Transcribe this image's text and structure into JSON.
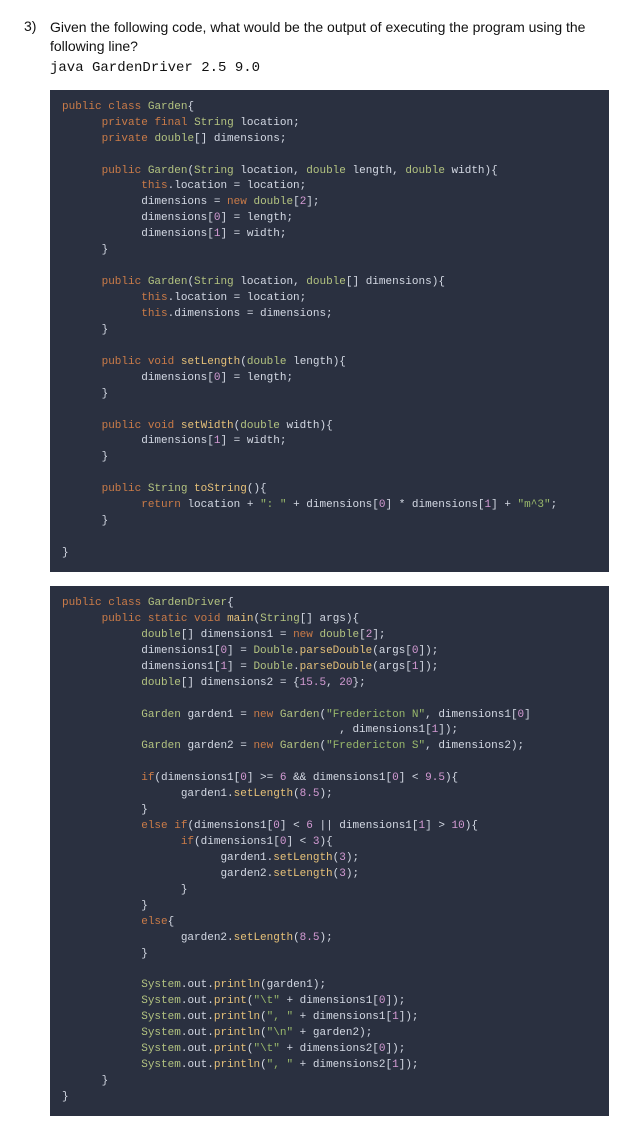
{
  "question": {
    "number": "3)",
    "prompt": "Given the following code, what would be the output of executing the program using the following line?",
    "command": "java GardenDriver 2.5 9.0"
  },
  "code1": {
    "tokens": [
      [
        "kw",
        "public"
      ],
      [
        "sp",
        " "
      ],
      [
        "kw",
        "class"
      ],
      [
        "sp",
        " "
      ],
      [
        "type",
        "Garden"
      ],
      [
        "punct",
        "{"
      ],
      [
        "nl"
      ],
      [
        "sp",
        "      "
      ],
      [
        "kw",
        "private"
      ],
      [
        "sp",
        " "
      ],
      [
        "kw",
        "final"
      ],
      [
        "sp",
        " "
      ],
      [
        "type",
        "String"
      ],
      [
        "sp",
        " "
      ],
      [
        "id",
        "location;"
      ],
      [
        "nl"
      ],
      [
        "sp",
        "      "
      ],
      [
        "kw",
        "private"
      ],
      [
        "sp",
        " "
      ],
      [
        "type",
        "double"
      ],
      [
        "punct",
        "[]"
      ],
      [
        "sp",
        " "
      ],
      [
        "id",
        "dimensions;"
      ],
      [
        "nl"
      ],
      [
        "nl"
      ],
      [
        "sp",
        "      "
      ],
      [
        "kw",
        "public"
      ],
      [
        "sp",
        " "
      ],
      [
        "type",
        "Garden"
      ],
      [
        "punct",
        "("
      ],
      [
        "type",
        "String"
      ],
      [
        "sp",
        " "
      ],
      [
        "id",
        "location, "
      ],
      [
        "type",
        "double"
      ],
      [
        "sp",
        " "
      ],
      [
        "id",
        "length, "
      ],
      [
        "type",
        "double"
      ],
      [
        "sp",
        " "
      ],
      [
        "id",
        "width"
      ],
      [
        "punct",
        "){"
      ],
      [
        "nl"
      ],
      [
        "sp",
        "            "
      ],
      [
        "kw",
        "this"
      ],
      [
        "punct",
        "."
      ],
      [
        "id",
        "location = location;"
      ],
      [
        "nl"
      ],
      [
        "sp",
        "            "
      ],
      [
        "id",
        "dimensions = "
      ],
      [
        "kw",
        "new"
      ],
      [
        "sp",
        " "
      ],
      [
        "type",
        "double"
      ],
      [
        "punct",
        "["
      ],
      [
        "num",
        "2"
      ],
      [
        "punct",
        "];"
      ],
      [
        "nl"
      ],
      [
        "sp",
        "            "
      ],
      [
        "id",
        "dimensions["
      ],
      [
        "num",
        "0"
      ],
      [
        "id",
        "] = length;"
      ],
      [
        "nl"
      ],
      [
        "sp",
        "            "
      ],
      [
        "id",
        "dimensions["
      ],
      [
        "num",
        "1"
      ],
      [
        "id",
        "] = width;"
      ],
      [
        "nl"
      ],
      [
        "sp",
        "      "
      ],
      [
        "punct",
        "}"
      ],
      [
        "nl"
      ],
      [
        "nl"
      ],
      [
        "sp",
        "      "
      ],
      [
        "kw",
        "public"
      ],
      [
        "sp",
        " "
      ],
      [
        "type",
        "Garden"
      ],
      [
        "punct",
        "("
      ],
      [
        "type",
        "String"
      ],
      [
        "sp",
        " "
      ],
      [
        "id",
        "location, "
      ],
      [
        "type",
        "double"
      ],
      [
        "punct",
        "[]"
      ],
      [
        "sp",
        " "
      ],
      [
        "id",
        "dimensions"
      ],
      [
        "punct",
        "){"
      ],
      [
        "nl"
      ],
      [
        "sp",
        "            "
      ],
      [
        "kw",
        "this"
      ],
      [
        "punct",
        "."
      ],
      [
        "id",
        "location = location;"
      ],
      [
        "nl"
      ],
      [
        "sp",
        "            "
      ],
      [
        "kw",
        "this"
      ],
      [
        "punct",
        "."
      ],
      [
        "id",
        "dimensions = dimensions;"
      ],
      [
        "nl"
      ],
      [
        "sp",
        "      "
      ],
      [
        "punct",
        "}"
      ],
      [
        "nl"
      ],
      [
        "nl"
      ],
      [
        "sp",
        "      "
      ],
      [
        "kw",
        "public"
      ],
      [
        "sp",
        " "
      ],
      [
        "kw",
        "void"
      ],
      [
        "sp",
        " "
      ],
      [
        "fn",
        "setLength"
      ],
      [
        "punct",
        "("
      ],
      [
        "type",
        "double"
      ],
      [
        "sp",
        " "
      ],
      [
        "id",
        "length"
      ],
      [
        "punct",
        "){"
      ],
      [
        "nl"
      ],
      [
        "sp",
        "            "
      ],
      [
        "id",
        "dimensions["
      ],
      [
        "num",
        "0"
      ],
      [
        "id",
        "] = length;"
      ],
      [
        "nl"
      ],
      [
        "sp",
        "      "
      ],
      [
        "punct",
        "}"
      ],
      [
        "nl"
      ],
      [
        "nl"
      ],
      [
        "sp",
        "      "
      ],
      [
        "kw",
        "public"
      ],
      [
        "sp",
        " "
      ],
      [
        "kw",
        "void"
      ],
      [
        "sp",
        " "
      ],
      [
        "fn",
        "setWidth"
      ],
      [
        "punct",
        "("
      ],
      [
        "type",
        "double"
      ],
      [
        "sp",
        " "
      ],
      [
        "id",
        "width"
      ],
      [
        "punct",
        "){"
      ],
      [
        "nl"
      ],
      [
        "sp",
        "            "
      ],
      [
        "id",
        "dimensions["
      ],
      [
        "num",
        "1"
      ],
      [
        "id",
        "] = width;"
      ],
      [
        "nl"
      ],
      [
        "sp",
        "      "
      ],
      [
        "punct",
        "}"
      ],
      [
        "nl"
      ],
      [
        "nl"
      ],
      [
        "sp",
        "      "
      ],
      [
        "kw",
        "public"
      ],
      [
        "sp",
        " "
      ],
      [
        "type",
        "String"
      ],
      [
        "sp",
        " "
      ],
      [
        "fn",
        "toString"
      ],
      [
        "punct",
        "(){"
      ],
      [
        "nl"
      ],
      [
        "sp",
        "            "
      ],
      [
        "kw",
        "return"
      ],
      [
        "sp",
        " "
      ],
      [
        "id",
        "location + "
      ],
      [
        "str",
        "\": \""
      ],
      [
        "id",
        " + dimensions["
      ],
      [
        "num",
        "0"
      ],
      [
        "id",
        "] * dimensions["
      ],
      [
        "num",
        "1"
      ],
      [
        "id",
        "] + "
      ],
      [
        "str",
        "\"m^3\""
      ],
      [
        "punct",
        ";"
      ],
      [
        "nl"
      ],
      [
        "sp",
        "      "
      ],
      [
        "punct",
        "}"
      ],
      [
        "nl"
      ],
      [
        "nl"
      ],
      [
        "punct",
        "}"
      ]
    ]
  },
  "code2": {
    "tokens": [
      [
        "kw",
        "public"
      ],
      [
        "sp",
        " "
      ],
      [
        "kw",
        "class"
      ],
      [
        "sp",
        " "
      ],
      [
        "type",
        "GardenDriver"
      ],
      [
        "punct",
        "{"
      ],
      [
        "nl"
      ],
      [
        "sp",
        "      "
      ],
      [
        "kw",
        "public"
      ],
      [
        "sp",
        " "
      ],
      [
        "kw",
        "static"
      ],
      [
        "sp",
        " "
      ],
      [
        "kw",
        "void"
      ],
      [
        "sp",
        " "
      ],
      [
        "fn",
        "main"
      ],
      [
        "punct",
        "("
      ],
      [
        "type",
        "String"
      ],
      [
        "punct",
        "[]"
      ],
      [
        "sp",
        " "
      ],
      [
        "id",
        "args"
      ],
      [
        "punct",
        "){"
      ],
      [
        "nl"
      ],
      [
        "sp",
        "            "
      ],
      [
        "type",
        "double"
      ],
      [
        "punct",
        "[]"
      ],
      [
        "sp",
        " "
      ],
      [
        "id",
        "dimensions1 = "
      ],
      [
        "kw",
        "new"
      ],
      [
        "sp",
        " "
      ],
      [
        "type",
        "double"
      ],
      [
        "punct",
        "["
      ],
      [
        "num",
        "2"
      ],
      [
        "punct",
        "];"
      ],
      [
        "nl"
      ],
      [
        "sp",
        "            "
      ],
      [
        "id",
        "dimensions1["
      ],
      [
        "num",
        "0"
      ],
      [
        "id",
        "] = "
      ],
      [
        "type",
        "Double"
      ],
      [
        "punct",
        "."
      ],
      [
        "fn",
        "parseDouble"
      ],
      [
        "punct",
        "("
      ],
      [
        "id",
        "args["
      ],
      [
        "num",
        "0"
      ],
      [
        "id",
        "]"
      ],
      [
        "punct",
        ");"
      ],
      [
        "nl"
      ],
      [
        "sp",
        "            "
      ],
      [
        "id",
        "dimensions1["
      ],
      [
        "num",
        "1"
      ],
      [
        "id",
        "] = "
      ],
      [
        "type",
        "Double"
      ],
      [
        "punct",
        "."
      ],
      [
        "fn",
        "parseDouble"
      ],
      [
        "punct",
        "("
      ],
      [
        "id",
        "args["
      ],
      [
        "num",
        "1"
      ],
      [
        "id",
        "]"
      ],
      [
        "punct",
        ");"
      ],
      [
        "nl"
      ],
      [
        "sp",
        "            "
      ],
      [
        "type",
        "double"
      ],
      [
        "punct",
        "[]"
      ],
      [
        "sp",
        " "
      ],
      [
        "id",
        "dimensions2 = {"
      ],
      [
        "num",
        "15.5"
      ],
      [
        "id",
        ", "
      ],
      [
        "num",
        "20"
      ],
      [
        "punct",
        "};"
      ],
      [
        "nl"
      ],
      [
        "nl"
      ],
      [
        "sp",
        "            "
      ],
      [
        "type",
        "Garden"
      ],
      [
        "sp",
        " "
      ],
      [
        "id",
        "garden1 = "
      ],
      [
        "kw",
        "new"
      ],
      [
        "sp",
        " "
      ],
      [
        "type",
        "Garden"
      ],
      [
        "punct",
        "("
      ],
      [
        "str",
        "\"Fredericton N\""
      ],
      [
        "id",
        ", dimensions1["
      ],
      [
        "num",
        "0"
      ],
      [
        "id",
        "]"
      ],
      [
        "nl"
      ],
      [
        "sp",
        "                                          "
      ],
      [
        "id",
        ", dimensions1["
      ],
      [
        "num",
        "1"
      ],
      [
        "id",
        "]"
      ],
      [
        "punct",
        ");"
      ],
      [
        "nl"
      ],
      [
        "sp",
        "            "
      ],
      [
        "type",
        "Garden"
      ],
      [
        "sp",
        " "
      ],
      [
        "id",
        "garden2 = "
      ],
      [
        "kw",
        "new"
      ],
      [
        "sp",
        " "
      ],
      [
        "type",
        "Garden"
      ],
      [
        "punct",
        "("
      ],
      [
        "str",
        "\"Fredericton S\""
      ],
      [
        "id",
        ", dimensions2"
      ],
      [
        "punct",
        ");"
      ],
      [
        "nl"
      ],
      [
        "nl"
      ],
      [
        "sp",
        "            "
      ],
      [
        "kw",
        "if"
      ],
      [
        "punct",
        "("
      ],
      [
        "id",
        "dimensions1["
      ],
      [
        "num",
        "0"
      ],
      [
        "id",
        "] >= "
      ],
      [
        "num",
        "6"
      ],
      [
        "id",
        " && dimensions1["
      ],
      [
        "num",
        "0"
      ],
      [
        "id",
        "] < "
      ],
      [
        "num",
        "9.5"
      ],
      [
        "punct",
        "){"
      ],
      [
        "nl"
      ],
      [
        "sp",
        "                  "
      ],
      [
        "id",
        "garden1."
      ],
      [
        "fn",
        "setLength"
      ],
      [
        "punct",
        "("
      ],
      [
        "num",
        "8.5"
      ],
      [
        "punct",
        ");"
      ],
      [
        "nl"
      ],
      [
        "sp",
        "            "
      ],
      [
        "punct",
        "}"
      ],
      [
        "nl"
      ],
      [
        "sp",
        "            "
      ],
      [
        "kw",
        "else"
      ],
      [
        "sp",
        " "
      ],
      [
        "kw",
        "if"
      ],
      [
        "punct",
        "("
      ],
      [
        "id",
        "dimensions1["
      ],
      [
        "num",
        "0"
      ],
      [
        "id",
        "] < "
      ],
      [
        "num",
        "6"
      ],
      [
        "id",
        " || dimensions1["
      ],
      [
        "num",
        "1"
      ],
      [
        "id",
        "] > "
      ],
      [
        "num",
        "10"
      ],
      [
        "punct",
        "){"
      ],
      [
        "nl"
      ],
      [
        "sp",
        "                  "
      ],
      [
        "kw",
        "if"
      ],
      [
        "punct",
        "("
      ],
      [
        "id",
        "dimensions1["
      ],
      [
        "num",
        "0"
      ],
      [
        "id",
        "] < "
      ],
      [
        "num",
        "3"
      ],
      [
        "punct",
        "){"
      ],
      [
        "nl"
      ],
      [
        "sp",
        "                        "
      ],
      [
        "id",
        "garden1."
      ],
      [
        "fn",
        "setLength"
      ],
      [
        "punct",
        "("
      ],
      [
        "num",
        "3"
      ],
      [
        "punct",
        ");"
      ],
      [
        "nl"
      ],
      [
        "sp",
        "                        "
      ],
      [
        "id",
        "garden2."
      ],
      [
        "fn",
        "setLength"
      ],
      [
        "punct",
        "("
      ],
      [
        "num",
        "3"
      ],
      [
        "punct",
        ");"
      ],
      [
        "nl"
      ],
      [
        "sp",
        "                  "
      ],
      [
        "punct",
        "}"
      ],
      [
        "nl"
      ],
      [
        "sp",
        "            "
      ],
      [
        "punct",
        "}"
      ],
      [
        "nl"
      ],
      [
        "sp",
        "            "
      ],
      [
        "kw",
        "else"
      ],
      [
        "punct",
        "{"
      ],
      [
        "nl"
      ],
      [
        "sp",
        "                  "
      ],
      [
        "id",
        "garden2."
      ],
      [
        "fn",
        "setLength"
      ],
      [
        "punct",
        "("
      ],
      [
        "num",
        "8.5"
      ],
      [
        "punct",
        ");"
      ],
      [
        "nl"
      ],
      [
        "sp",
        "            "
      ],
      [
        "punct",
        "}"
      ],
      [
        "nl"
      ],
      [
        "nl"
      ],
      [
        "sp",
        "            "
      ],
      [
        "type",
        "System"
      ],
      [
        "punct",
        "."
      ],
      [
        "id",
        "out."
      ],
      [
        "fn",
        "println"
      ],
      [
        "punct",
        "("
      ],
      [
        "id",
        "garden1"
      ],
      [
        "punct",
        ");"
      ],
      [
        "nl"
      ],
      [
        "sp",
        "            "
      ],
      [
        "type",
        "System"
      ],
      [
        "punct",
        "."
      ],
      [
        "id",
        "out."
      ],
      [
        "fn",
        "print"
      ],
      [
        "punct",
        "("
      ],
      [
        "str",
        "\"\\t\""
      ],
      [
        "id",
        " + dimensions1["
      ],
      [
        "num",
        "0"
      ],
      [
        "id",
        "]"
      ],
      [
        "punct",
        ");"
      ],
      [
        "nl"
      ],
      [
        "sp",
        "            "
      ],
      [
        "type",
        "System"
      ],
      [
        "punct",
        "."
      ],
      [
        "id",
        "out."
      ],
      [
        "fn",
        "println"
      ],
      [
        "punct",
        "("
      ],
      [
        "str",
        "\", \""
      ],
      [
        "id",
        " + dimensions1["
      ],
      [
        "num",
        "1"
      ],
      [
        "id",
        "]"
      ],
      [
        "punct",
        ");"
      ],
      [
        "nl"
      ],
      [
        "sp",
        "            "
      ],
      [
        "type",
        "System"
      ],
      [
        "punct",
        "."
      ],
      [
        "id",
        "out."
      ],
      [
        "fn",
        "println"
      ],
      [
        "punct",
        "("
      ],
      [
        "str",
        "\"\\n\""
      ],
      [
        "id",
        " + garden2"
      ],
      [
        "punct",
        ");"
      ],
      [
        "nl"
      ],
      [
        "sp",
        "            "
      ],
      [
        "type",
        "System"
      ],
      [
        "punct",
        "."
      ],
      [
        "id",
        "out."
      ],
      [
        "fn",
        "print"
      ],
      [
        "punct",
        "("
      ],
      [
        "str",
        "\"\\t\""
      ],
      [
        "id",
        " + dimensions2["
      ],
      [
        "num",
        "0"
      ],
      [
        "id",
        "]"
      ],
      [
        "punct",
        ");"
      ],
      [
        "nl"
      ],
      [
        "sp",
        "            "
      ],
      [
        "type",
        "System"
      ],
      [
        "punct",
        "."
      ],
      [
        "id",
        "out."
      ],
      [
        "fn",
        "println"
      ],
      [
        "punct",
        "("
      ],
      [
        "str",
        "\", \""
      ],
      [
        "id",
        " + dimensions2["
      ],
      [
        "num",
        "1"
      ],
      [
        "id",
        "]"
      ],
      [
        "punct",
        ");"
      ],
      [
        "nl"
      ],
      [
        "sp",
        "      "
      ],
      [
        "punct",
        "}"
      ],
      [
        "nl"
      ],
      [
        "punct",
        "}"
      ]
    ]
  }
}
